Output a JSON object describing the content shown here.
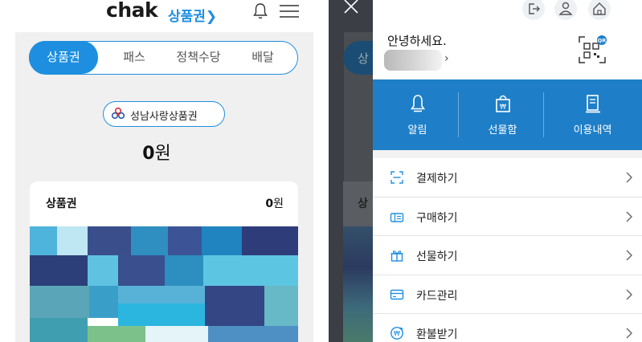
{
  "left": {
    "logo": "chak",
    "logo_sub": "상품권❯",
    "icons": [
      "bell-icon",
      "hamburger-menu-icon"
    ],
    "tabs": [
      {
        "label": "상품권",
        "active": true
      },
      {
        "label": "패스",
        "active": false
      },
      {
        "label": "정책수당",
        "active": false
      },
      {
        "label": "배달",
        "active": false
      }
    ],
    "voucher_chip": "성남사랑상품권",
    "balance_value": "0",
    "balance_unit": "원",
    "card": {
      "title": "상품권",
      "amount_value": "0",
      "amount_unit": "원"
    }
  },
  "right": {
    "behind_tab": "상",
    "behind_card": "상",
    "top_icons": [
      "logout-icon",
      "user-icon",
      "home-icon"
    ],
    "greeting": "안녕하세요.",
    "name_caret": "›",
    "qr_badge": "QR",
    "quick_actions": [
      {
        "label": "알림",
        "icon": "bell-icon"
      },
      {
        "label": "선물함",
        "icon": "gift-bag-icon"
      },
      {
        "label": "이용내역",
        "icon": "receipt-icon"
      }
    ],
    "menu": [
      {
        "label": "결제하기",
        "icon": "scan-icon"
      },
      {
        "label": "구매하기",
        "icon": "money-icon"
      },
      {
        "label": "선물하기",
        "icon": "gift-icon"
      },
      {
        "label": "카드관리",
        "icon": "card-icon"
      },
      {
        "label": "환불받기",
        "icon": "refund-icon"
      }
    ]
  },
  "colors": {
    "accent": "#1e8fe0",
    "drawer_blue": "#1e7fc8",
    "overlay": "#3b3f45"
  }
}
